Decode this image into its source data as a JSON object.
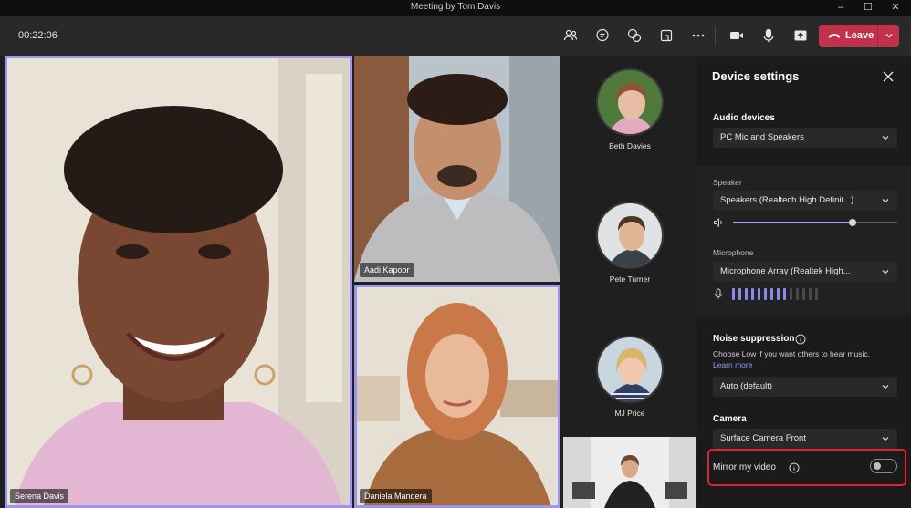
{
  "window": {
    "title": "Meeting by Tom Davis",
    "minimize": "–",
    "maximize": "☐",
    "close": "✕"
  },
  "toolbar": {
    "timer": "00:22:06",
    "leave_label": "Leave"
  },
  "participants": {
    "serena": "Serena Davis",
    "aadi": "Aadi Kapoor",
    "daniela": "Daniela Mandera",
    "beth": "Beth Davies",
    "pete": "Pete Turner",
    "mj": "MJ Price"
  },
  "device_settings": {
    "title": "Device settings",
    "audio_devices_label": "Audio devices",
    "audio_device": "PC Mic and Speakers",
    "speaker_label": "Speaker",
    "speaker_value": "Speakers (Realtech High Definit...)",
    "speaker_volume": 0.73,
    "microphone_label": "Microphone",
    "microphone_value": "Microphone Array (Realtek High...",
    "mic_level_active_bars": 9,
    "mic_level_total_bars": 14,
    "noise_label": "Noise suppression",
    "noise_desc": "Choose Low if you want others to hear music.",
    "learn_more": "Learn more",
    "noise_value": "Auto (default)",
    "camera_label": "Camera",
    "camera_value": "Surface Camera Front",
    "mirror_label": "Mirror my video",
    "mirror_on": false
  },
  "colors": {
    "accent": "#9d94ee",
    "leave": "#c4314b",
    "highlight": "#e0242f"
  }
}
